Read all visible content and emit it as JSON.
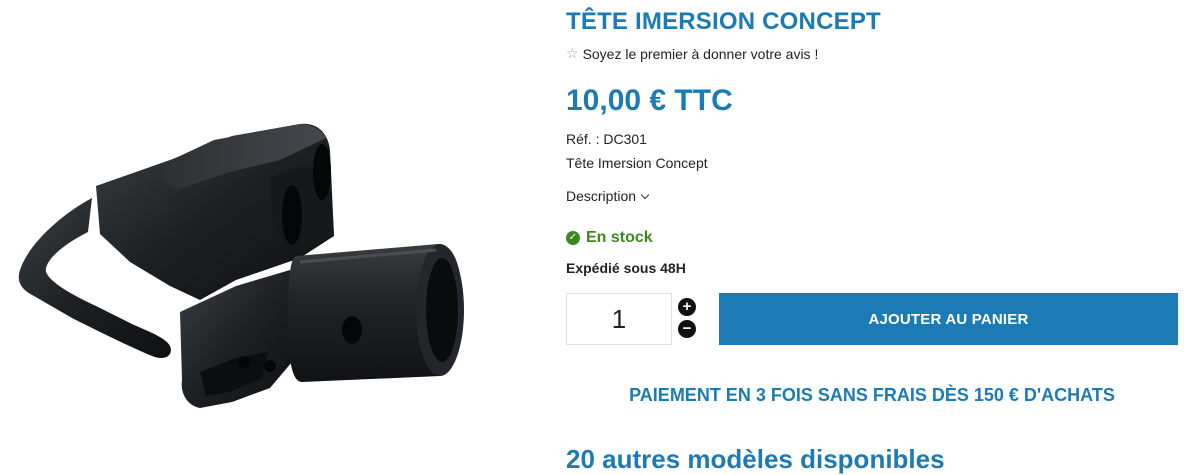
{
  "product": {
    "title": "TÊTE IMERSION CONCEPT",
    "rating_text": "Soyez le premier à donner votre avis !",
    "price": "10,00 € TTC",
    "reference": "Réf. : DC301",
    "short_description": "Tête Imersion Concept",
    "description_label": "Description",
    "stock_status": "En stock",
    "shipping": "Expédié sous 48H",
    "quantity": "1",
    "add_to_cart_label": "AJOUTER AU PANIER",
    "payment_info": "PAIEMENT EN 3 FOIS SANS FRAIS DÈS 150 € D'ACHATS",
    "other_models": "20 autres modèles disponibles"
  },
  "icons": {
    "star": "star-outline-icon",
    "stock": "check-circle-icon",
    "plus": "plus-circle-icon",
    "minus": "minus-circle-icon",
    "chevron": "chevron-down-icon"
  },
  "colors": {
    "accent": "#1c7bb4",
    "stock_green": "#3a8a1f",
    "product_black": "#1b1d1e"
  }
}
